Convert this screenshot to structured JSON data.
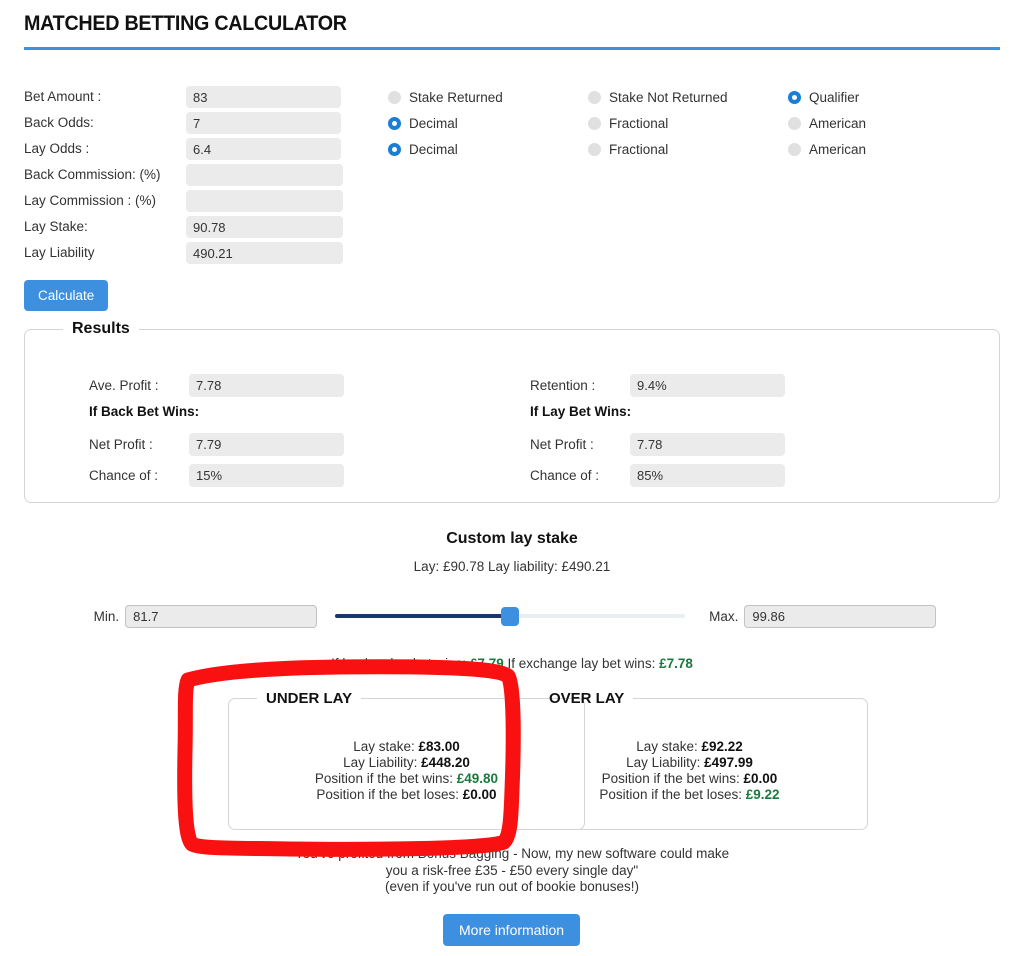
{
  "header": {
    "title": "MATCHED BETTING CALCULATOR",
    "rule_color": "#3d8fdf"
  },
  "form": {
    "rows": [
      {
        "label": "Bet Amount :",
        "value": "83"
      },
      {
        "label": "Back Odds:",
        "value": "7"
      },
      {
        "label": "Lay Odds :",
        "value": "6.4"
      },
      {
        "label": "Back Commission: (%)",
        "value": ""
      },
      {
        "label": "Lay Commission : (%)",
        "value": ""
      },
      {
        "label": "Lay Stake:",
        "value": "90.78"
      },
      {
        "label": "Lay Liability",
        "value": "490.21"
      }
    ]
  },
  "radios": {
    "col1": [
      {
        "label": "Stake Returned",
        "selected": false
      },
      {
        "label": "Decimal",
        "selected": true
      },
      {
        "label": "Decimal",
        "selected": true
      }
    ],
    "col2": [
      {
        "label": "Stake Not Returned",
        "selected": false
      },
      {
        "label": "Fractional",
        "selected": false
      },
      {
        "label": "Fractional",
        "selected": false
      }
    ],
    "col3": [
      {
        "label": "Qualifier",
        "selected": true
      },
      {
        "label": "American",
        "selected": false
      },
      {
        "label": "American",
        "selected": false
      }
    ],
    "selected_color": "#1a7fd4",
    "unselected_color": "#e0e0e0"
  },
  "calculate_button": {
    "label": "Calculate",
    "color": "#3d8fdf"
  },
  "results": {
    "legend": "Results",
    "left": {
      "ave_profit_label": "Ave. Profit :",
      "ave_profit_value": "7.78",
      "heading": "If Back Bet Wins:",
      "net_profit_label": "Net Profit :",
      "net_profit_value": "7.79",
      "chance_label": "Chance of :",
      "chance_value": "15%"
    },
    "right": {
      "retention_label": "Retention :",
      "retention_value": "9.4%",
      "heading": "If Lay Bet Wins:",
      "net_profit_label": "Net Profit :",
      "net_profit_value": "7.78",
      "chance_label": "Chance of :",
      "chance_value": "85%"
    }
  },
  "custom_lay_stake": {
    "heading": "Custom lay stake",
    "subtitle": "Lay: £90.78 Lay liability: £490.21",
    "min_label": "Min.",
    "min_value": "81.7",
    "max_label": "Max.",
    "max_value": "99.86",
    "slider_percent": "50",
    "track_fill_color": "#18376b",
    "track_color": "#e8eef1",
    "thumb_color": "#3d8fdf"
  },
  "summary": {
    "prefix": "If bookmaker bet wins:",
    "back_win_amount": "£7.79",
    "middle": "If exchange lay bet wins:",
    "lay_win_amount": "£7.78"
  },
  "under_lay": {
    "legend": "UNDER LAY",
    "lay_stake_label": "Lay stake:",
    "lay_stake_value": "£83.00",
    "lay_liability_label": "Lay Liability:",
    "lay_liability_value": "£448.20",
    "bet_wins_label": "Position if the bet wins:",
    "bet_wins_value": "£49.80",
    "bet_loses_label": "Position if the bet loses:",
    "bet_loses_value": "£0.00"
  },
  "over_lay": {
    "legend": "OVER LAY",
    "lay_stake_label": "Lay stake:",
    "lay_stake_value": "£92.22",
    "lay_liability_label": "Lay Liability:",
    "lay_liability_value": "£497.99",
    "bet_wins_label": "Position if the bet wins:",
    "bet_wins_value": "£0.00",
    "bet_loses_label": "Position if the bet loses:",
    "bet_loses_value": "£9.22"
  },
  "promo": {
    "line1": "You've profited from Bonus Bagging - Now, my new software could make",
    "line2": "you a risk-free £35 - £50 every single day\"",
    "line3": "(even if you've run out of bookie bonuses!)",
    "button_label": "More information"
  },
  "annotation": {
    "color": "#f91111",
    "shape": "hand-drawn-rectangle",
    "target": "under-lay-box"
  }
}
